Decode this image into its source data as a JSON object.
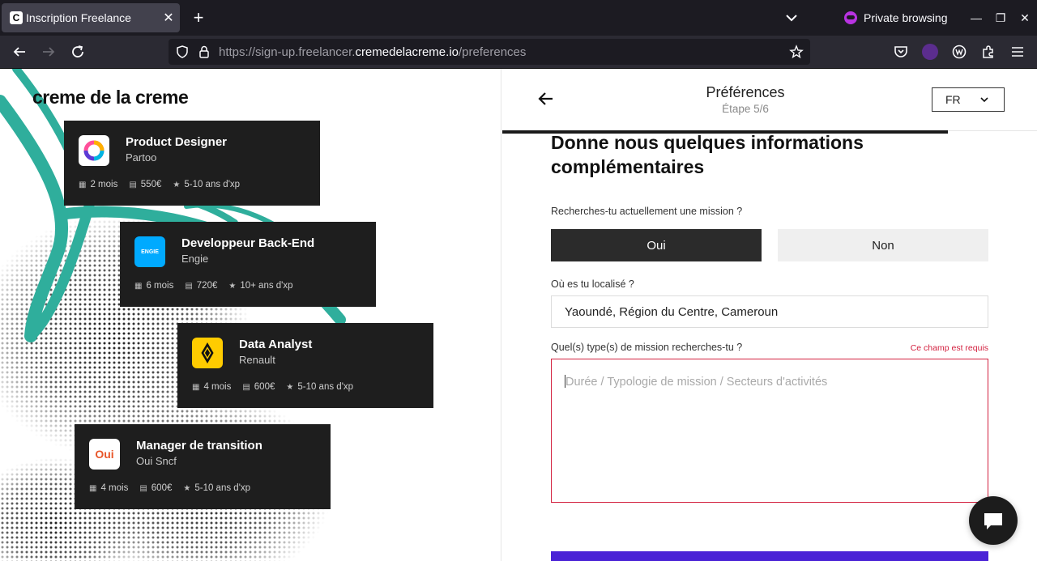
{
  "browser": {
    "tab_title": "Inscription Freelance",
    "tab_favicon": "C",
    "private_label": "Private browsing",
    "url_prefix": "https://sign-up.freelancer.",
    "url_host": "cremedelacreme.io",
    "url_path": "/preferences"
  },
  "left": {
    "logo": "creme de la creme",
    "cards": [
      {
        "title": "Product Designer",
        "company": "Partoo",
        "duration": "2 mois",
        "rate": "550€",
        "xp": "5-10 ans d'xp"
      },
      {
        "title": "Developpeur Back-End",
        "company": "Engie",
        "duration": "6 mois",
        "rate": "720€",
        "xp": "10+ ans d'xp",
        "logo_text": "ENGIE"
      },
      {
        "title": "Data Analyst",
        "company": "Renault",
        "duration": "4 mois",
        "rate": "600€",
        "xp": "5-10 ans d'xp"
      },
      {
        "title": "Manager de transition",
        "company": "Oui Sncf",
        "duration": "4 mois",
        "rate": "600€",
        "xp": "5-10 ans d'xp",
        "logo_text": "Oui"
      }
    ]
  },
  "form": {
    "header_title": "Préférences",
    "header_step": "Étape 5/6",
    "lang": "FR",
    "heading": "Donne nous quelques informations complémentaires",
    "q1_label": "Recherches-tu actuellement une mission ?",
    "yes": "Oui",
    "no": "Non",
    "q2_label": "Où es tu localisé ?",
    "location_value": "Yaoundé, Région du Centre, Cameroun",
    "q3_label": "Quel(s) type(s) de mission recherches-tu ?",
    "required_msg": "Ce champ est requis",
    "mission_placeholder": "Durée / Typologie de mission / Secteurs d'activités"
  },
  "colors": {
    "accent_submit": "#4a22d6",
    "error": "#d3203f",
    "teal_stroke": "#2fae9c"
  }
}
